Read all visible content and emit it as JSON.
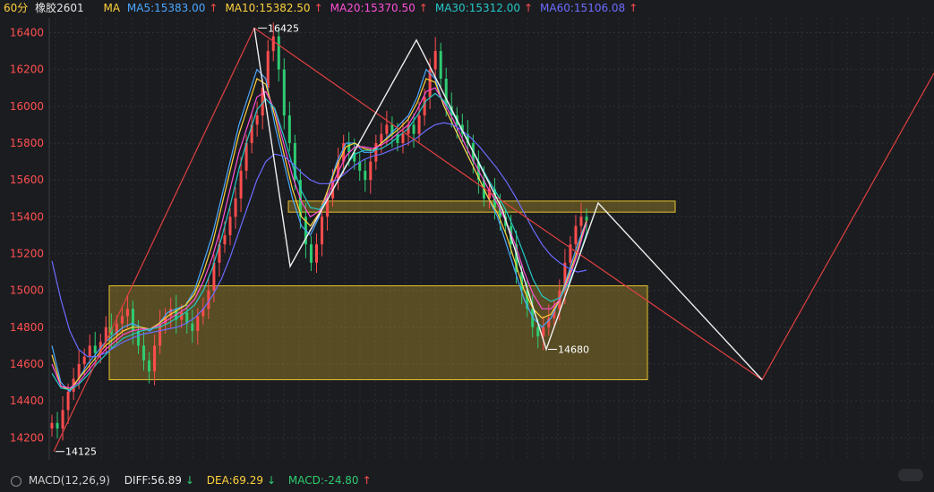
{
  "header": {
    "period": "60分",
    "symbol": "橡胶2601",
    "ma_label": "MA",
    "ma_items": [
      {
        "text": "MA5:15383.00",
        "arrow": "↑",
        "color": "#4aa8ff"
      },
      {
        "text": "MA10:15382.50",
        "arrow": "↑",
        "color": "#ffd23c"
      },
      {
        "text": "MA20:15370.50",
        "arrow": "↑",
        "color": "#ff4fd8"
      },
      {
        "text": "MA30:15312.00",
        "arrow": "↑",
        "color": "#25c8c8"
      },
      {
        "text": "MA60:15106.08",
        "arrow": "↑",
        "color": "#6c6cff"
      }
    ]
  },
  "footer": {
    "macd_label": "MACD(12,26,9)",
    "diff": "DIFF:56.89",
    "diff_arrow": "↓",
    "dea": "DEA:69.29",
    "dea_arrow": "↓",
    "macd": "MACD:-24.80",
    "macd_arrow": "↑"
  },
  "chart_data": {
    "type": "candlestick",
    "y_ticks": [
      14200,
      14400,
      14600,
      14800,
      15000,
      15200,
      15400,
      15600,
      15800,
      16000,
      16200,
      16400
    ],
    "ylim": [
      14080,
      16480
    ],
    "grid": true,
    "annotations": [
      {
        "text": "16425",
        "kind": "high"
      },
      {
        "text": "14125",
        "kind": "low"
      },
      {
        "text": "14680",
        "kind": "low"
      }
    ],
    "zones": [
      {
        "from": 14515,
        "to": 15025,
        "color": "#c8a62a"
      },
      {
        "from": 15425,
        "to": 15485,
        "color": "#c8a62a"
      }
    ],
    "close_path": [
      14280,
      14250,
      14350,
      14450,
      14520,
      14600,
      14640,
      14700,
      14660,
      14720,
      14800,
      14760,
      14820,
      14860,
      14900,
      14780,
      14700,
      14620,
      14560,
      14700,
      14820,
      14860,
      14900,
      14840,
      14880,
      14820,
      14780,
      14860,
      14900,
      15000,
      15150,
      15250,
      15300,
      15400,
      15500,
      15650,
      15800,
      15900,
      15950,
      16100,
      16300,
      16380,
      16200,
      15950,
      15800,
      15600,
      15400,
      15250,
      15150,
      15250,
      15400,
      15500,
      15600,
      15700,
      15800,
      15750,
      15700,
      15650,
      15600,
      15700,
      15800,
      15850,
      15900,
      15850,
      15800,
      15850,
      15900,
      15850,
      15950,
      16050,
      16200,
      16300,
      16150,
      16000,
      15950,
      15900,
      15850,
      15800,
      15700,
      15600,
      15500,
      15550,
      15450,
      15400,
      15350,
      15250,
      15100,
      15000,
      14900,
      14800,
      14750,
      14800,
      14850,
      14900,
      15000,
      15150,
      15250,
      15350,
      15400,
      15380
    ],
    "ma_paths": {
      "ma5": [
        14700,
        14500,
        14450,
        14520,
        14600,
        14660,
        14720,
        14760,
        14800,
        14820,
        14800,
        14780,
        14820,
        14880,
        14900,
        14920,
        15000,
        15150,
        15300,
        15500,
        15700,
        15900,
        16050,
        16200,
        16150,
        15900,
        15700,
        15500,
        15350,
        15300,
        15400,
        15550,
        15700,
        15800,
        15800,
        15750,
        15750,
        15800,
        15850,
        15900,
        15950,
        16050,
        16200,
        16150,
        16000,
        15900,
        15800,
        15700,
        15600,
        15500,
        15400,
        15250,
        15100,
        14950,
        14850,
        14800,
        14850,
        14950,
        15100,
        15250,
        15380
      ],
      "ma10": [
        14650,
        14480,
        14460,
        14520,
        14580,
        14640,
        14700,
        14740,
        14780,
        14800,
        14800,
        14790,
        14820,
        14860,
        14890,
        14920,
        14980,
        15100,
        15250,
        15450,
        15650,
        15850,
        16000,
        16150,
        16120,
        15950,
        15750,
        15550,
        15400,
        15350,
        15420,
        15550,
        15680,
        15780,
        15800,
        15770,
        15760,
        15800,
        15840,
        15880,
        15930,
        16020,
        16150,
        16130,
        16000,
        15900,
        15800,
        15700,
        15600,
        15500,
        15420,
        15300,
        15150,
        15000,
        14900,
        14850,
        14870,
        14950,
        15080,
        15220,
        15380
      ],
      "ma20": [
        14600,
        14480,
        14470,
        14500,
        14560,
        14620,
        14680,
        14720,
        14760,
        14780,
        14790,
        14790,
        14810,
        14840,
        14870,
        14900,
        14950,
        15050,
        15180,
        15350,
        15550,
        15750,
        15900,
        16050,
        16080,
        15980,
        15800,
        15620,
        15480,
        15400,
        15430,
        15520,
        15630,
        15730,
        15780,
        15780,
        15770,
        15790,
        15820,
        15860,
        15900,
        15980,
        16080,
        16100,
        16020,
        15930,
        15830,
        15730,
        15640,
        15550,
        15470,
        15370,
        15250,
        15100,
        14980,
        14900,
        14900,
        14950,
        15060,
        15200,
        15370
      ],
      "ma30": [
        14550,
        14470,
        14460,
        14490,
        14540,
        14600,
        14650,
        14700,
        14740,
        14760,
        14780,
        14790,
        14800,
        14820,
        14850,
        14880,
        14920,
        15000,
        15120,
        15280,
        15460,
        15660,
        15830,
        15980,
        16040,
        15990,
        15840,
        15680,
        15540,
        15450,
        15440,
        15500,
        15590,
        15680,
        15740,
        15760,
        15760,
        15770,
        15800,
        15840,
        15880,
        15950,
        16030,
        16070,
        16030,
        15960,
        15870,
        15780,
        15690,
        15600,
        15520,
        15430,
        15320,
        15190,
        15060,
        14970,
        14940,
        14960,
        15040,
        15160,
        15310
      ],
      "ma60": [
        15160,
        14950,
        14780,
        14680,
        14640,
        14640,
        14660,
        14690,
        14720,
        14740,
        14760,
        14770,
        14780,
        14790,
        14800,
        14820,
        14850,
        14900,
        14970,
        15060,
        15180,
        15320,
        15460,
        15600,
        15700,
        15740,
        15730,
        15690,
        15640,
        15600,
        15580,
        15580,
        15600,
        15640,
        15680,
        15710,
        15730,
        15740,
        15760,
        15780,
        15800,
        15830,
        15870,
        15900,
        15910,
        15900,
        15870,
        15830,
        15780,
        15720,
        15660,
        15590,
        15510,
        15420,
        15330,
        15250,
        15190,
        15150,
        15120,
        15100,
        15110
      ]
    },
    "zigzag_red": [
      14125,
      16425,
      15485,
      14515,
      16180
    ],
    "zigzag_white": [
      16425,
      15130,
      16360,
      15440,
      14680,
      15475,
      14515
    ]
  }
}
